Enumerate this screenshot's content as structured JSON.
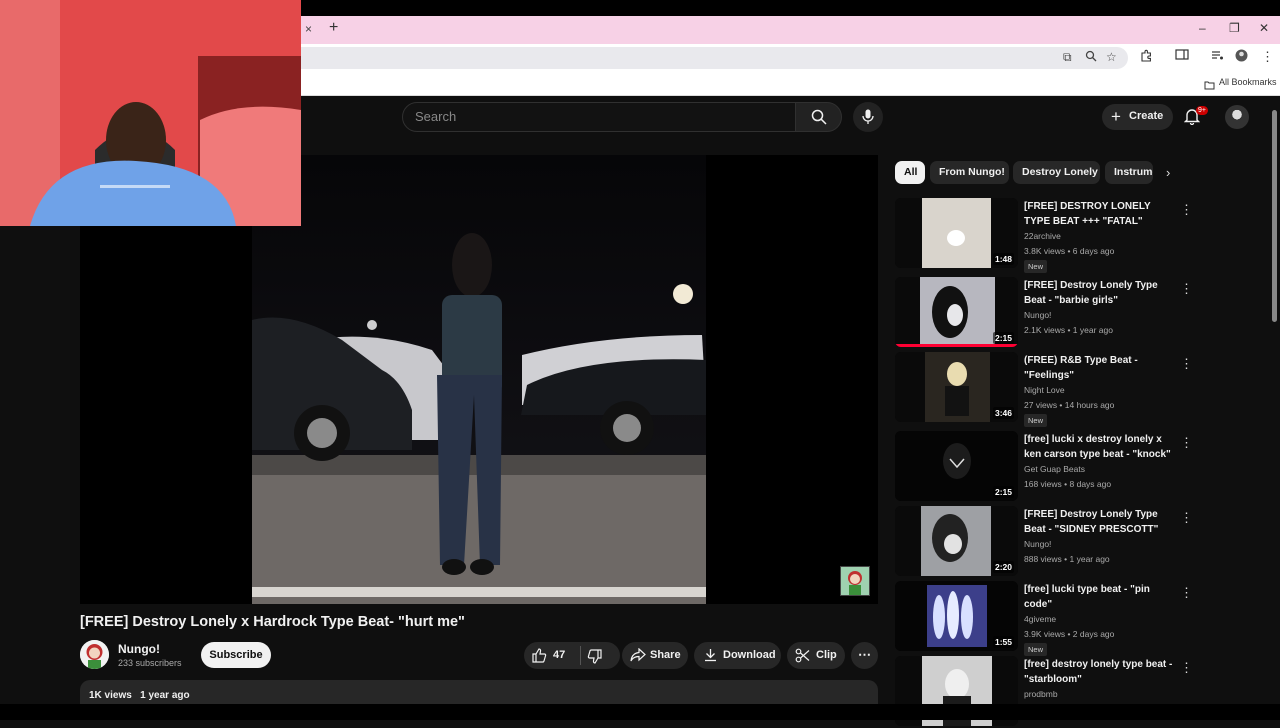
{
  "browser": {
    "tab_close": "×",
    "new_tab": "+",
    "win_min": "–",
    "win_max": "❐",
    "win_close": "✕",
    "bookmarks_label": "All Bookmarks"
  },
  "header": {
    "search_placeholder": "Search",
    "create_label": "Create",
    "notification_count": "9+"
  },
  "video": {
    "title": "[FREE] Destroy Lonely x Hardrock Type Beat- \"hurt me\"",
    "channel": "Nungo!",
    "subscribers": "233 subscribers",
    "subscribe_label": "Subscribe",
    "likes": "47",
    "share_label": "Share",
    "download_label": "Download",
    "clip_label": "Clip",
    "views": "1K views",
    "age": "1 year ago"
  },
  "chips": [
    "All",
    "From Nungo!",
    "Destroy Lonely",
    "Instrumentals"
  ],
  "recommendations": [
    {
      "title": "[FREE] DESTROY LONELY TYPE BEAT +++ \"FATAL\"",
      "channel": "22archive",
      "meta": "3.8K views • 6 days ago",
      "duration": "1:48",
      "badge": "New",
      "watched": 0
    },
    {
      "title": "[FREE] Destroy Lonely Type Beat - \"barbie girls\"",
      "channel": "Nungo!",
      "meta": "2.1K views • 1 year ago",
      "duration": "2:15",
      "badge": "",
      "watched": 1.0
    },
    {
      "title": "(FREE) R&B Type Beat - \"Feelings\"",
      "channel": "Night Love",
      "meta": "27 views • 14 hours ago",
      "duration": "3:46",
      "badge": "New",
      "watched": 0
    },
    {
      "title": "[free] lucki x destroy lonely x ken carson type beat - \"knock\"",
      "channel": "Get Guap Beats",
      "meta": "168 views • 8 days ago",
      "duration": "2:15",
      "badge": "",
      "watched": 0
    },
    {
      "title": "[FREE] Destroy Lonely Type Beat - \"SIDNEY PRESCOTT\"",
      "channel": "Nungo!",
      "meta": "888 views • 1 year ago",
      "duration": "2:20",
      "badge": "",
      "watched": 0
    },
    {
      "title": "[free] lucki type beat - \"pin code\"",
      "channel": "4giveme",
      "meta": "3.9K views • 2 days ago",
      "duration": "1:55",
      "badge": "New",
      "watched": 0
    },
    {
      "title": "[free] destroy lonely type beat - \"starbloom\"",
      "channel": "prodbmb",
      "meta": "",
      "duration": "",
      "badge": "",
      "watched": 0
    }
  ],
  "icons": {
    "search": "search-icon",
    "mic": "mic-icon",
    "bell": "bell-icon",
    "like": "thumbs-up-icon",
    "dislike": "thumbs-down-icon",
    "share": "share-icon",
    "download": "download-icon",
    "clip": "scissors-icon",
    "more": "more-horiz-icon"
  }
}
